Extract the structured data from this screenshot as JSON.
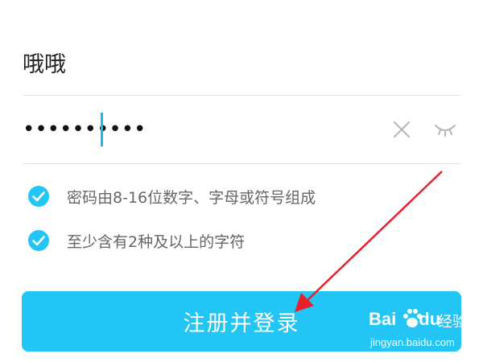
{
  "form": {
    "username": "哦哦",
    "password_masked": "••••••••••",
    "rules": [
      {
        "text": "密码由8-16位数字、字母或符号组成",
        "checked": true
      },
      {
        "text": "至少含有2种及以上的字符",
        "checked": true
      }
    ],
    "submit_label": "注册并登录"
  },
  "icons": {
    "clear": "close-icon",
    "visibility": "eye-closed-icon",
    "check": "check-circle-icon"
  },
  "colors": {
    "accent": "#22c5f3",
    "caret": "#17b9ea",
    "annotation_arrow": "#e8202a"
  },
  "watermark": {
    "brand_left": "Bai",
    "brand_right": "du",
    "product": "经验",
    "url": "jingyan.baidu.com"
  }
}
